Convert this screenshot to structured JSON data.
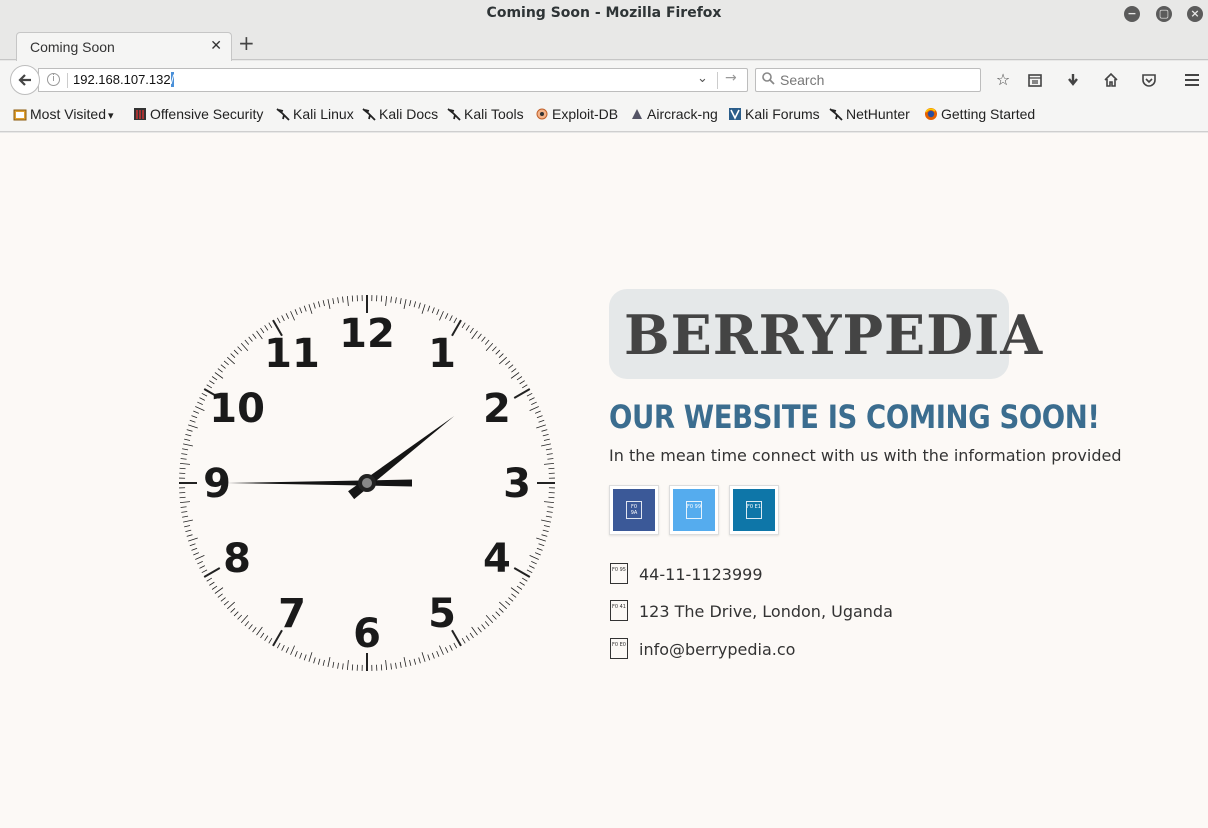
{
  "window": {
    "title": "Coming Soon - Mozilla Firefox"
  },
  "tabs": [
    {
      "label": "Coming Soon",
      "active": true
    }
  ],
  "navbar": {
    "url_main": "192.168.107.132",
    "url_selected": "/",
    "search_placeholder": "Search"
  },
  "bookmarks": [
    {
      "label": "Most Visited",
      "icon": "folder-icon",
      "dropdown": true
    },
    {
      "label": "Offensive Security",
      "icon": "offsec-icon"
    },
    {
      "label": "Kali Linux",
      "icon": "kali-dragon-icon"
    },
    {
      "label": "Kali Docs",
      "icon": "kali-dragon-icon"
    },
    {
      "label": "Kali Tools",
      "icon": "kali-dragon-icon"
    },
    {
      "label": "Exploit-DB",
      "icon": "exploitdb-icon"
    },
    {
      "label": "Aircrack-ng",
      "icon": "aircrack-icon"
    },
    {
      "label": "Kali Forums",
      "icon": "kali-forums-icon"
    },
    {
      "label": "NetHunter",
      "icon": "kali-dragon-icon"
    },
    {
      "label": "Getting Started",
      "icon": "firefox-icon"
    }
  ],
  "page": {
    "logo": "BERRYPEDIA",
    "headline": "OUR WEBSITE IS COMING SOON!",
    "subline": "In the mean time connect with us with the information provided",
    "social": [
      {
        "name": "facebook",
        "color": "#3b5998",
        "glyph": "F0 9A"
      },
      {
        "name": "twitter",
        "color": "#55acee",
        "glyph": "F0 99"
      },
      {
        "name": "linkedin",
        "color": "#0e76a8",
        "glyph": "F0 E1"
      }
    ],
    "contacts": [
      {
        "icon": "phone-icon",
        "glyph": "F0 95",
        "text": "44-11-1123999"
      },
      {
        "icon": "map-marker-icon",
        "glyph": "F0 41",
        "text": "123 The Drive, London, Uganda"
      },
      {
        "icon": "envelope-icon",
        "glyph": "F0 E0",
        "text": "info@berrypedia.co"
      }
    ],
    "clock": {
      "numerals": [
        "12",
        "1",
        "2",
        "3",
        "4",
        "5",
        "6",
        "7",
        "8",
        "9",
        "10",
        "11"
      ],
      "time": "1:45"
    }
  }
}
